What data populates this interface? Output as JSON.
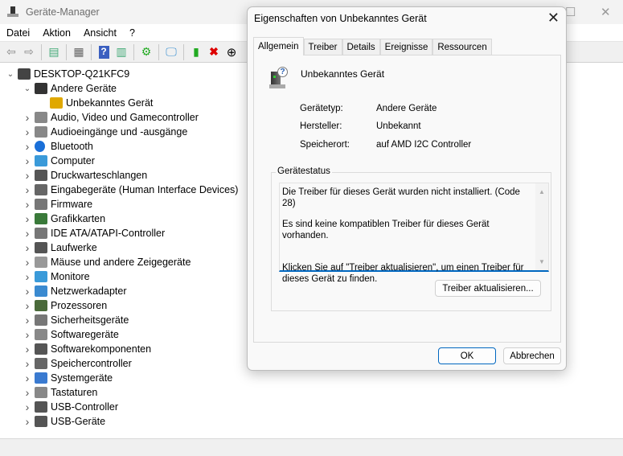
{
  "window": {
    "title": "Geräte-Manager"
  },
  "menu": [
    "Datei",
    "Aktion",
    "Ansicht",
    "?"
  ],
  "toolbar": [
    "back-icon",
    "forward-icon",
    "show-hide-console-tree-icon",
    "properties-icon",
    "help-icon",
    "action-pane-icon",
    "update-driver-icon",
    "scan-hardware-icon",
    "enable-device-icon",
    "uninstall-icon",
    "disable-icon"
  ],
  "tree": [
    {
      "label": "DESKTOP-Q21KFC9",
      "depth": 0,
      "expanded": true,
      "icon": "computer-icon"
    },
    {
      "label": "Andere Geräte",
      "depth": 1,
      "expanded": true,
      "icon": "unknown-device-icon"
    },
    {
      "label": "Unbekanntes Gerät",
      "depth": 2,
      "icon": "warning-device-icon"
    },
    {
      "label": "Audio, Video und Gamecontroller",
      "depth": 1,
      "icon": "speaker-icon"
    },
    {
      "label": "Audioeingänge und -ausgänge",
      "depth": 1,
      "icon": "speaker-icon"
    },
    {
      "label": "Bluetooth",
      "depth": 1,
      "icon": "bluetooth-icon"
    },
    {
      "label": "Computer",
      "depth": 1,
      "icon": "monitor-icon"
    },
    {
      "label": "Druckwarteschlangen",
      "depth": 1,
      "icon": "printer-icon"
    },
    {
      "label": "Eingabegeräte (Human Interface Devices)",
      "depth": 1,
      "icon": "hid-icon"
    },
    {
      "label": "Firmware",
      "depth": 1,
      "icon": "firmware-icon"
    },
    {
      "label": "Grafikkarten",
      "depth": 1,
      "icon": "display-adapter-icon"
    },
    {
      "label": "IDE ATA/ATAPI-Controller",
      "depth": 1,
      "icon": "ide-icon"
    },
    {
      "label": "Laufwerke",
      "depth": 1,
      "icon": "disk-icon"
    },
    {
      "label": "Mäuse und andere Zeigegeräte",
      "depth": 1,
      "icon": "mouse-icon"
    },
    {
      "label": "Monitore",
      "depth": 1,
      "icon": "monitor-icon"
    },
    {
      "label": "Netzwerkadapter",
      "depth": 1,
      "icon": "network-icon"
    },
    {
      "label": "Prozessoren",
      "depth": 1,
      "icon": "cpu-icon"
    },
    {
      "label": "Sicherheitsgeräte",
      "depth": 1,
      "icon": "security-icon"
    },
    {
      "label": "Softwaregeräte",
      "depth": 1,
      "icon": "software-device-icon"
    },
    {
      "label": "Softwarekomponenten",
      "depth": 1,
      "icon": "puzzle-icon"
    },
    {
      "label": "Speichercontroller",
      "depth": 1,
      "icon": "storage-icon"
    },
    {
      "label": "Systemgeräte",
      "depth": 1,
      "icon": "system-icon"
    },
    {
      "label": "Tastaturen",
      "depth": 1,
      "icon": "keyboard-icon"
    },
    {
      "label": "USB-Controller",
      "depth": 1,
      "icon": "usb-icon"
    },
    {
      "label": "USB-Geräte",
      "depth": 1,
      "icon": "usb-icon"
    }
  ],
  "dialog": {
    "title": "Eigenschaften von Unbekanntes Gerät",
    "tabs": [
      "Allgemein",
      "Treiber",
      "Details",
      "Ereignisse",
      "Ressourcen"
    ],
    "device_name": "Unbekanntes Gerät",
    "props": [
      {
        "label": "Gerätetyp:",
        "value": "Andere Geräte"
      },
      {
        "label": "Hersteller:",
        "value": "Unbekannt"
      },
      {
        "label": "Speicherort:",
        "value": "auf AMD I2C Controller"
      }
    ],
    "status_title": "Gerätestatus",
    "status_lines": [
      "Die Treiber für dieses Gerät wurden nicht installiert. (Code 28)",
      "Es sind keine kompatiblen Treiber für dieses Gerät vorhanden.",
      "Klicken Sie auf \"Treiber aktualisieren\", um einen Treiber für dieses Gerät zu finden."
    ],
    "update_button": "Treiber aktualisieren...",
    "ok": "OK",
    "cancel": "Abbrechen"
  },
  "colors": {
    "accent": "#0067c0"
  }
}
